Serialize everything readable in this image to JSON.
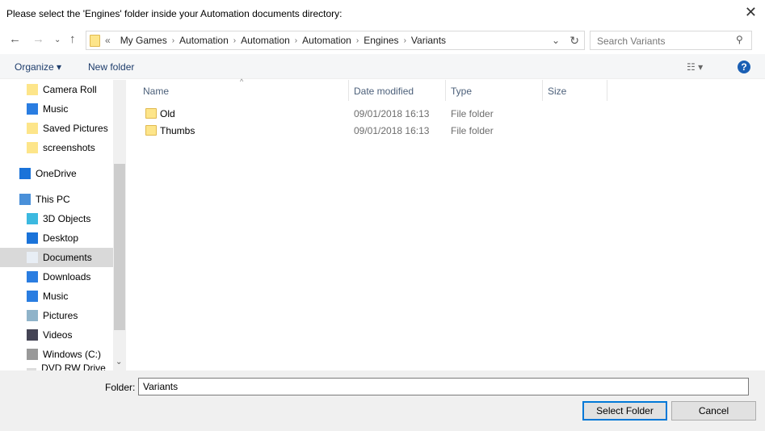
{
  "title": "Please select the 'Engines' folder inside your Automation documents directory:",
  "breadcrumb": {
    "overflow": "«",
    "items": [
      "My Games",
      "Automation",
      "Automation",
      "Automation",
      "Engines",
      "Variants"
    ]
  },
  "search": {
    "placeholder": "Search Variants"
  },
  "toolbar": {
    "organize": "Organize ▾",
    "new_folder": "New folder"
  },
  "sidebar": {
    "items": [
      {
        "label": "Camera Roll",
        "icon": "folder-icon"
      },
      {
        "label": "Music",
        "icon": "music-icon"
      },
      {
        "label": "Saved Pictures",
        "icon": "folder-icon"
      },
      {
        "label": "screenshots",
        "icon": "folder-icon"
      },
      {
        "label": "OneDrive",
        "icon": "cloud-icon"
      },
      {
        "label": "This PC",
        "icon": "computer-icon"
      },
      {
        "label": "3D Objects",
        "icon": "cube-icon"
      },
      {
        "label": "Desktop",
        "icon": "desktop-icon"
      },
      {
        "label": "Documents",
        "icon": "document-icon"
      },
      {
        "label": "Downloads",
        "icon": "download-icon"
      },
      {
        "label": "Music",
        "icon": "music-icon"
      },
      {
        "label": "Pictures",
        "icon": "pictures-icon"
      },
      {
        "label": "Videos",
        "icon": "video-icon"
      },
      {
        "label": "Windows (C:)",
        "icon": "drive-icon"
      },
      {
        "label": "DVD RW Drive (D:)",
        "icon": "dvd-icon"
      }
    ]
  },
  "columns": [
    "Name",
    "Date modified",
    "Type",
    "Size"
  ],
  "files": [
    {
      "name": "Old",
      "date": "09/01/2018 16:13",
      "type": "File folder"
    },
    {
      "name": "Thumbs",
      "date": "09/01/2018 16:13",
      "type": "File folder"
    }
  ],
  "footer": {
    "folder_label": "Folder:",
    "folder_value": "Variants",
    "select": "Select Folder",
    "cancel": "Cancel"
  }
}
